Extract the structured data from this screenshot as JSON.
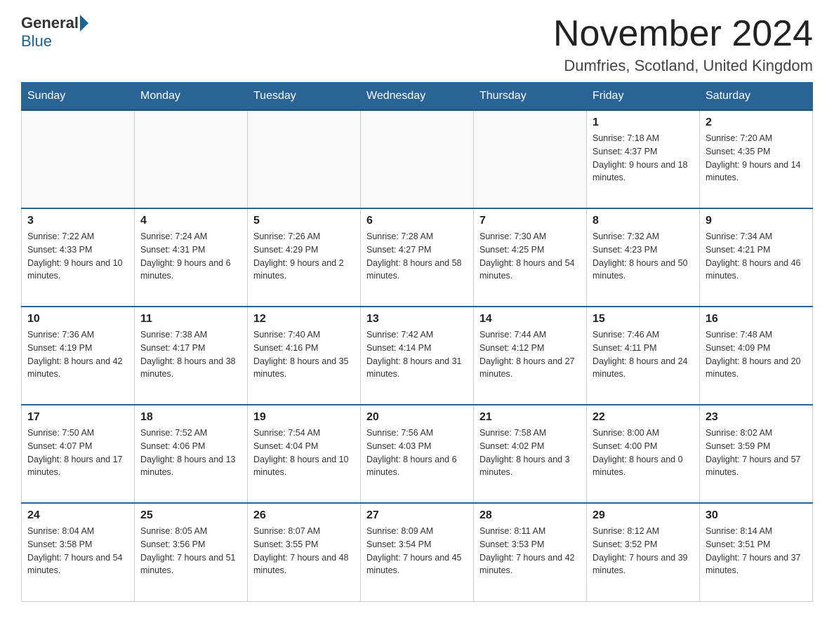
{
  "header": {
    "logo_general": "General",
    "logo_blue": "Blue",
    "month_title": "November 2024",
    "location": "Dumfries, Scotland, United Kingdom"
  },
  "days_of_week": [
    "Sunday",
    "Monday",
    "Tuesday",
    "Wednesday",
    "Thursday",
    "Friday",
    "Saturday"
  ],
  "weeks": [
    [
      {
        "day": "",
        "info": ""
      },
      {
        "day": "",
        "info": ""
      },
      {
        "day": "",
        "info": ""
      },
      {
        "day": "",
        "info": ""
      },
      {
        "day": "",
        "info": ""
      },
      {
        "day": "1",
        "info": "Sunrise: 7:18 AM\nSunset: 4:37 PM\nDaylight: 9 hours and 18 minutes."
      },
      {
        "day": "2",
        "info": "Sunrise: 7:20 AM\nSunset: 4:35 PM\nDaylight: 9 hours and 14 minutes."
      }
    ],
    [
      {
        "day": "3",
        "info": "Sunrise: 7:22 AM\nSunset: 4:33 PM\nDaylight: 9 hours and 10 minutes."
      },
      {
        "day": "4",
        "info": "Sunrise: 7:24 AM\nSunset: 4:31 PM\nDaylight: 9 hours and 6 minutes."
      },
      {
        "day": "5",
        "info": "Sunrise: 7:26 AM\nSunset: 4:29 PM\nDaylight: 9 hours and 2 minutes."
      },
      {
        "day": "6",
        "info": "Sunrise: 7:28 AM\nSunset: 4:27 PM\nDaylight: 8 hours and 58 minutes."
      },
      {
        "day": "7",
        "info": "Sunrise: 7:30 AM\nSunset: 4:25 PM\nDaylight: 8 hours and 54 minutes."
      },
      {
        "day": "8",
        "info": "Sunrise: 7:32 AM\nSunset: 4:23 PM\nDaylight: 8 hours and 50 minutes."
      },
      {
        "day": "9",
        "info": "Sunrise: 7:34 AM\nSunset: 4:21 PM\nDaylight: 8 hours and 46 minutes."
      }
    ],
    [
      {
        "day": "10",
        "info": "Sunrise: 7:36 AM\nSunset: 4:19 PM\nDaylight: 8 hours and 42 minutes."
      },
      {
        "day": "11",
        "info": "Sunrise: 7:38 AM\nSunset: 4:17 PM\nDaylight: 8 hours and 38 minutes."
      },
      {
        "day": "12",
        "info": "Sunrise: 7:40 AM\nSunset: 4:16 PM\nDaylight: 8 hours and 35 minutes."
      },
      {
        "day": "13",
        "info": "Sunrise: 7:42 AM\nSunset: 4:14 PM\nDaylight: 8 hours and 31 minutes."
      },
      {
        "day": "14",
        "info": "Sunrise: 7:44 AM\nSunset: 4:12 PM\nDaylight: 8 hours and 27 minutes."
      },
      {
        "day": "15",
        "info": "Sunrise: 7:46 AM\nSunset: 4:11 PM\nDaylight: 8 hours and 24 minutes."
      },
      {
        "day": "16",
        "info": "Sunrise: 7:48 AM\nSunset: 4:09 PM\nDaylight: 8 hours and 20 minutes."
      }
    ],
    [
      {
        "day": "17",
        "info": "Sunrise: 7:50 AM\nSunset: 4:07 PM\nDaylight: 8 hours and 17 minutes."
      },
      {
        "day": "18",
        "info": "Sunrise: 7:52 AM\nSunset: 4:06 PM\nDaylight: 8 hours and 13 minutes."
      },
      {
        "day": "19",
        "info": "Sunrise: 7:54 AM\nSunset: 4:04 PM\nDaylight: 8 hours and 10 minutes."
      },
      {
        "day": "20",
        "info": "Sunrise: 7:56 AM\nSunset: 4:03 PM\nDaylight: 8 hours and 6 minutes."
      },
      {
        "day": "21",
        "info": "Sunrise: 7:58 AM\nSunset: 4:02 PM\nDaylight: 8 hours and 3 minutes."
      },
      {
        "day": "22",
        "info": "Sunrise: 8:00 AM\nSunset: 4:00 PM\nDaylight: 8 hours and 0 minutes."
      },
      {
        "day": "23",
        "info": "Sunrise: 8:02 AM\nSunset: 3:59 PM\nDaylight: 7 hours and 57 minutes."
      }
    ],
    [
      {
        "day": "24",
        "info": "Sunrise: 8:04 AM\nSunset: 3:58 PM\nDaylight: 7 hours and 54 minutes."
      },
      {
        "day": "25",
        "info": "Sunrise: 8:05 AM\nSunset: 3:56 PM\nDaylight: 7 hours and 51 minutes."
      },
      {
        "day": "26",
        "info": "Sunrise: 8:07 AM\nSunset: 3:55 PM\nDaylight: 7 hours and 48 minutes."
      },
      {
        "day": "27",
        "info": "Sunrise: 8:09 AM\nSunset: 3:54 PM\nDaylight: 7 hours and 45 minutes."
      },
      {
        "day": "28",
        "info": "Sunrise: 8:11 AM\nSunset: 3:53 PM\nDaylight: 7 hours and 42 minutes."
      },
      {
        "day": "29",
        "info": "Sunrise: 8:12 AM\nSunset: 3:52 PM\nDaylight: 7 hours and 39 minutes."
      },
      {
        "day": "30",
        "info": "Sunrise: 8:14 AM\nSunset: 3:51 PM\nDaylight: 7 hours and 37 minutes."
      }
    ]
  ]
}
